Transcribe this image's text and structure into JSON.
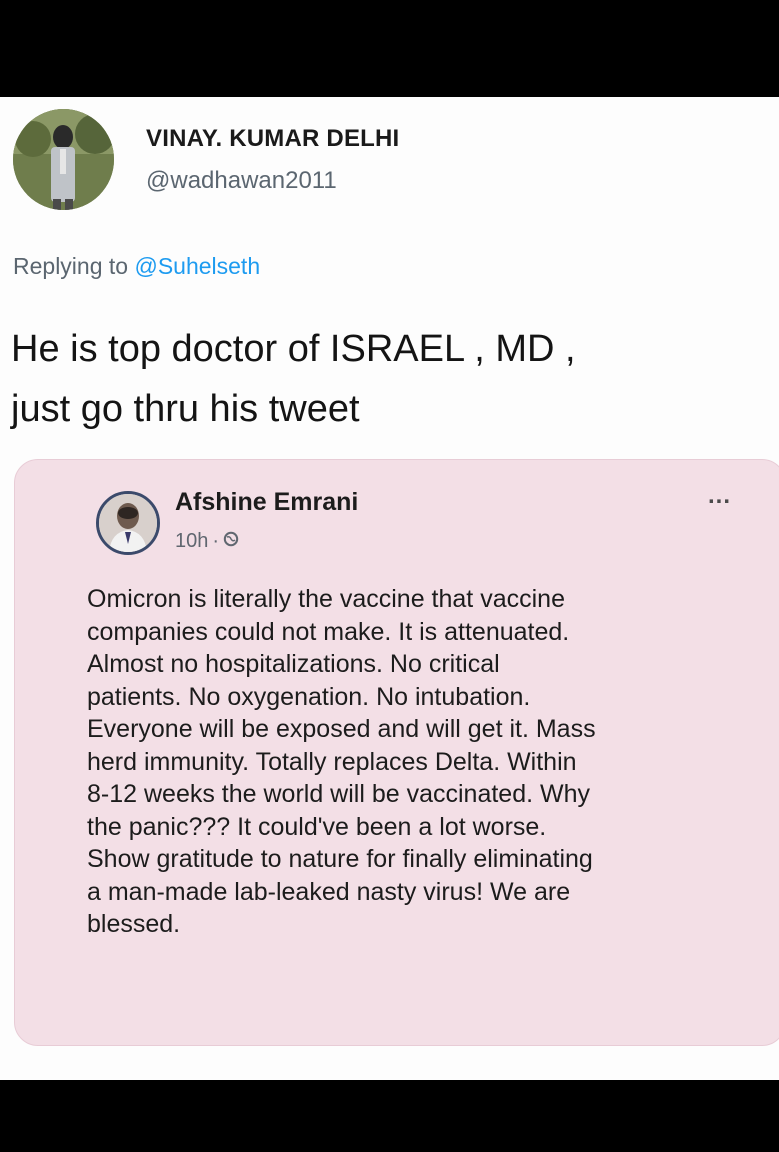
{
  "tweet": {
    "author_name": "VINAY. KUMAR DELHI",
    "author_handle": "@wadhawan2011",
    "replying_prefix": "Replying to",
    "replying_to": "@Suhelseth",
    "text_line1": "He is top doctor of ISRAEL , MD ,",
    "text_line2": "just go thru his tweet"
  },
  "embedded_post": {
    "author_name": "Afshine Emrani",
    "time": "10h",
    "separator": "·",
    "more_label": "...",
    "lines": [
      "Omicron is literally the vaccine that vaccine",
      "companies could not make.  It is attenuated.",
      "Almost no hospitalizations.  No critical",
      "patients.  No oxygenation.  No intubation.",
      "Everyone will be exposed and will get it.  Mass",
      "herd immunity.  Totally replaces Delta.  Within",
      "8-12 weeks the world will be vaccinated.  Why",
      "the panic???  It could've been a lot worse.",
      "Show gratitude to nature for finally eliminating",
      "a man-made lab-leaked nasty virus!  We are",
      "blessed."
    ]
  },
  "colors": {
    "background": "#000000",
    "card": "#fdfdfd",
    "embed_bg": "#f3dfe6",
    "mention": "#1d9bf0",
    "secondary_text": "#5b6670"
  },
  "icons": {
    "audience": "globe-icon",
    "menu": "more-options-icon"
  }
}
